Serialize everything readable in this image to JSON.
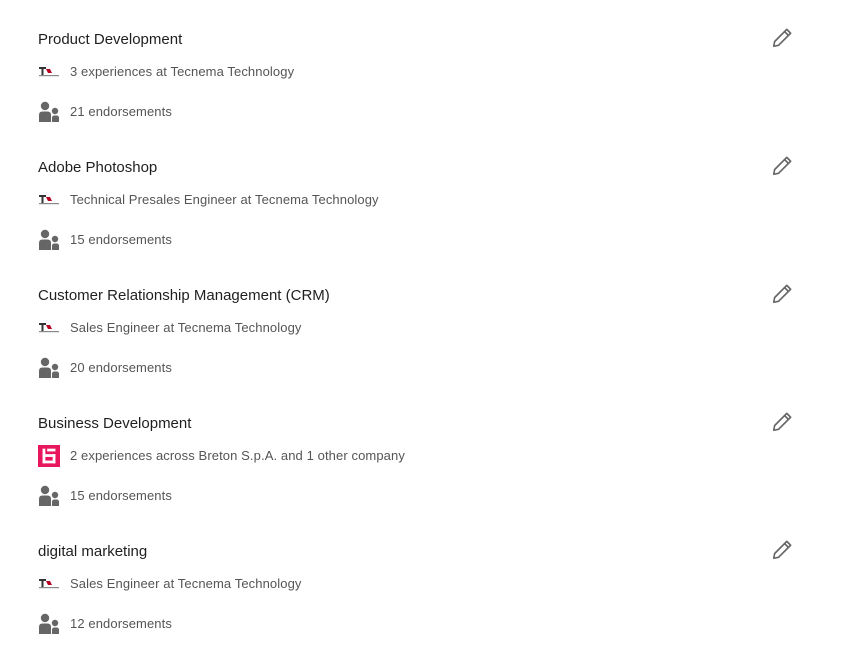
{
  "colors": {
    "title": "#1f1f1f",
    "meta": "#555555",
    "icon": "#666666",
    "breton_brand": "#e8175d"
  },
  "skills": [
    {
      "name": "Product Development",
      "context": "3 experiences at Tecnema Technology",
      "logo": "tecnema-logo",
      "endorsements": "21 endorsements"
    },
    {
      "name": "Adobe Photoshop",
      "context": "Technical Presales Engineer at Tecnema Technology",
      "logo": "tecnema-logo",
      "endorsements": "15 endorsements"
    },
    {
      "name": "Customer Relationship Management (CRM)",
      "context": "Sales Engineer at Tecnema Technology",
      "logo": "tecnema-logo",
      "endorsements": "20 endorsements"
    },
    {
      "name": "Business Development",
      "context": "2 experiences across Breton S.p.A. and 1 other company",
      "logo": "breton-logo",
      "endorsements": "15 endorsements"
    },
    {
      "name": "digital marketing",
      "context": "Sales Engineer at Tecnema Technology",
      "logo": "tecnema-logo",
      "endorsements": "12 endorsements"
    }
  ],
  "icons": {
    "edit": "pencil-icon",
    "endorsements": "people-icon"
  }
}
